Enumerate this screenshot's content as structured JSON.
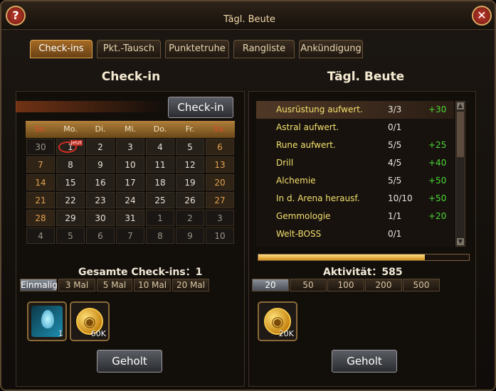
{
  "window": {
    "title": "Tägl. Beute"
  },
  "tabs": [
    {
      "label": "Check-ins",
      "active": true
    },
    {
      "label": "Pkt.-Tausch",
      "active": false
    },
    {
      "label": "Punktetruhe",
      "active": false
    },
    {
      "label": "Rangliste",
      "active": false
    },
    {
      "label": "Ankündigung",
      "active": false
    }
  ],
  "left": {
    "heading": "Check-in",
    "checkin_button": "Check-in",
    "calendar": {
      "weekdays": [
        "So.",
        "Mo.",
        "Di.",
        "Mi.",
        "Do.",
        "Fr.",
        "Sa."
      ],
      "today_badge": "jetzt",
      "weeks": [
        [
          "30",
          "1",
          "2",
          "3",
          "4",
          "5",
          "6"
        ],
        [
          "7",
          "8",
          "9",
          "10",
          "11",
          "12",
          "13"
        ],
        [
          "14",
          "15",
          "16",
          "17",
          "18",
          "19",
          "20"
        ],
        [
          "21",
          "22",
          "23",
          "24",
          "25",
          "26",
          "27"
        ],
        [
          "28",
          "29",
          "30",
          "31",
          "1",
          "2",
          "3"
        ],
        [
          "4",
          "5",
          "6",
          "7",
          "8",
          "9",
          "10"
        ]
      ]
    },
    "total_label": "Gesamte Check-ins：",
    "total_value": "1",
    "subtabs": [
      "Einmalig",
      "3 Mal",
      "5 Mal",
      "10 Mal",
      "20 Mal"
    ],
    "rewards": [
      {
        "icon": "potion-icon",
        "qty": "1"
      },
      {
        "icon": "gold-coin-icon",
        "qty": "60K"
      }
    ],
    "collect_button": "Geholt"
  },
  "right": {
    "heading": "Tägl. Beute",
    "tasks": [
      {
        "name": "Ausrüstung aufwert.",
        "count": "3/3",
        "points": "+30"
      },
      {
        "name": "Astral aufwert.",
        "count": "0/1",
        "points": ""
      },
      {
        "name": "Rune aufwert.",
        "count": "5/5",
        "points": "+25"
      },
      {
        "name": "Drill",
        "count": "4/5",
        "points": "+40"
      },
      {
        "name": "Alchemie",
        "count": "5/5",
        "points": "+50"
      },
      {
        "name": "In d. Arena herausf.",
        "count": "10/10",
        "points": "+50"
      },
      {
        "name": "Gemmologie",
        "count": "1/1",
        "points": "+20"
      },
      {
        "name": "Welt-BOSS",
        "count": "0/1",
        "points": ""
      }
    ],
    "activity_fill": 0.79,
    "activity_label": "Aktivität：",
    "activity_value": "585",
    "subtabs": [
      "20",
      "50",
      "100",
      "200",
      "500"
    ],
    "rewards": [
      {
        "icon": "gold-coin-icon",
        "qty": "20K"
      }
    ],
    "collect_button": "Geholt"
  },
  "colors": {
    "accent": "#c8832a",
    "gain": "#4cda36",
    "task_name": "#f3e06c",
    "weekend": "#e04b2c"
  }
}
